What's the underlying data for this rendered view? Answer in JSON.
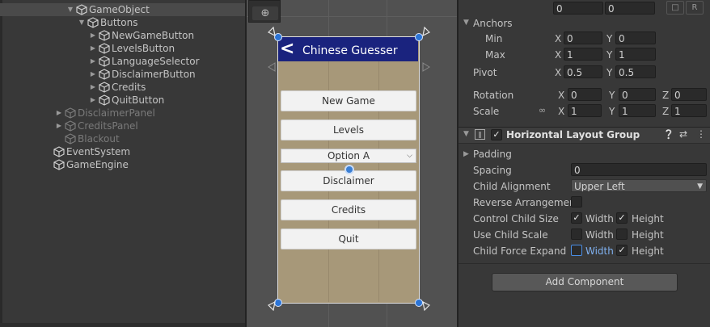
{
  "hierarchy": {
    "items": [
      {
        "label": "GameObject",
        "indent": 2,
        "expanded": true,
        "selected": true,
        "dim": false
      },
      {
        "label": "Buttons",
        "indent": 3,
        "expanded": true,
        "selected": false,
        "dim": false
      },
      {
        "label": "NewGameButton",
        "indent": 4,
        "expanded": false,
        "selected": false,
        "dim": false
      },
      {
        "label": "LevelsButton",
        "indent": 4,
        "expanded": false,
        "selected": false,
        "dim": false
      },
      {
        "label": "LanguageSelector",
        "indent": 4,
        "expanded": false,
        "selected": false,
        "dim": false
      },
      {
        "label": "DisclaimerButton",
        "indent": 4,
        "expanded": false,
        "selected": false,
        "dim": false
      },
      {
        "label": "Credits",
        "indent": 4,
        "expanded": false,
        "selected": false,
        "dim": false
      },
      {
        "label": "QuitButton",
        "indent": 4,
        "expanded": false,
        "selected": false,
        "dim": false
      },
      {
        "label": "DisclaimerPanel",
        "indent": 1,
        "expanded": false,
        "selected": false,
        "dim": true
      },
      {
        "label": "CreditsPanel",
        "indent": 1,
        "expanded": false,
        "selected": false,
        "dim": true
      },
      {
        "label": "Blackout",
        "indent": 1,
        "expanded": null,
        "selected": false,
        "dim": true
      },
      {
        "label": "EventSystem",
        "indent": 0,
        "expanded": null,
        "selected": false,
        "dim": false
      },
      {
        "label": "GameEngine",
        "indent": 0,
        "expanded": null,
        "selected": false,
        "dim": false
      }
    ]
  },
  "scene": {
    "game_title": "Chinese Guesser",
    "back_glyph": "<",
    "buttons": [
      "New Game",
      "Levels",
      "Disclaimer",
      "Credits",
      "Quit"
    ],
    "dropdown_value": "Option A",
    "toolbar_icon": "⊕",
    "canvas_bg": "#a79879",
    "titlebar_color": "#1a237e"
  },
  "inspector": {
    "top_fields": [
      "0",
      "0"
    ],
    "anchors_label": "Anchors",
    "min_label": "Min",
    "min_x": "0",
    "min_y": "0",
    "max_label": "Max",
    "max_x": "1",
    "max_y": "1",
    "pivot_label": "Pivot",
    "pivot_x": "0.5",
    "pivot_y": "0.5",
    "rotation_label": "Rotation",
    "rot_x": "0",
    "rot_y": "0",
    "rot_z": "0",
    "scale_label": "Scale",
    "scale_x": "1",
    "scale_y": "1",
    "scale_z": "1",
    "axis_x": "X",
    "axis_y": "Y",
    "axis_z": "Z",
    "blueprint_btn": "R",
    "component_title": "Horizontal Layout Group",
    "padding_label": "Padding",
    "spacing_label": "Spacing",
    "spacing_value": "0",
    "child_alignment_label": "Child Alignment",
    "child_alignment_value": "Upper Left",
    "reverse_label": "Reverse Arrangement",
    "control_child_size_label": "Control Child Size",
    "use_child_scale_label": "Use Child Scale",
    "child_force_expand_label": "Child Force Expand",
    "width_label": "Width",
    "height_label": "Height",
    "add_component_label": "Add Component",
    "check_glyph": "✓"
  }
}
